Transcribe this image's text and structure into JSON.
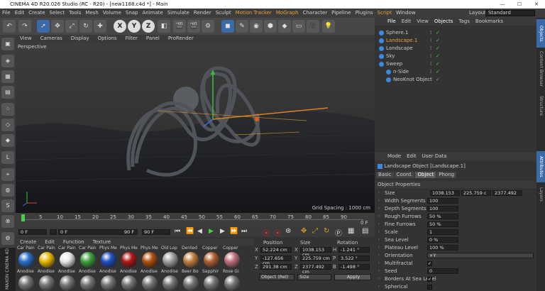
{
  "title_bar": {
    "text": "CINEMA 4D R20.026 Studio (RC - R20) - [new1188.c4d *] - Main"
  },
  "menu": {
    "items": [
      "File",
      "Edit",
      "Create",
      "Select",
      "Tools",
      "Mesh",
      "Volume",
      "Snap",
      "Animate",
      "Simulate",
      "Render",
      "Sculpt",
      "Motion Tracker",
      "MoGraph",
      "Character",
      "Pipeline",
      "Plugins",
      "Script",
      "Window"
    ],
    "layout_label": "Layout:",
    "layout_value": "Standard"
  },
  "toolbar": {
    "x": "X",
    "y": "Y",
    "z": "Z"
  },
  "viewport": {
    "menu": [
      "View",
      "Cameras",
      "Display",
      "Options",
      "Filter",
      "Panel",
      "ProRender"
    ],
    "label": "Perspective",
    "grid_spacing": "Grid Spacing : 1000 cm"
  },
  "timeline": {
    "ticks": [
      "0",
      "5",
      "10",
      "15",
      "20",
      "25",
      "30",
      "35",
      "40",
      "45",
      "50",
      "55",
      "60",
      "65",
      "70",
      "75",
      "80",
      "85",
      "90"
    ],
    "end_label": "0 F"
  },
  "transport": {
    "start": "0 F",
    "current": "0 F",
    "end": "90 F",
    "end2": "90 F"
  },
  "materials": {
    "menu": [
      "Create",
      "Edit",
      "Function",
      "Texture"
    ],
    "top_labels": [
      "Car Pain",
      "Car Pain",
      "Car Pain",
      "Car Pain",
      "Phys Me",
      "Phys Me",
      "Phys Me",
      "Old Lop",
      "Dented",
      "Copper",
      "Copper"
    ],
    "bottom_labels": [
      "Anodise",
      "Anodise",
      "Anodise",
      "Anodise",
      "Anodise",
      "Anodise",
      "Anodise",
      "Anodise",
      "Beer Bo",
      "Sapphir",
      "Rose Gi"
    ],
    "colors": [
      "#2a70c8",
      "#e8b800",
      "#e8e8e8",
      "#40a040",
      "#2050c0",
      "#b01818",
      "#b05010",
      "#a0a0a0",
      "#c08040",
      "#b06030",
      "#c07080"
    ]
  },
  "coordinates": {
    "headers": [
      "Position",
      "Size",
      "Rotation"
    ],
    "rows": [
      {
        "axis": "X",
        "pos": "52.224 cm",
        "size_axis": "X",
        "size": "1038.153 cm",
        "rot_axis": "H",
        "rot": "-1.241 °"
      },
      {
        "axis": "Y",
        "pos": "-127.656 cm",
        "size_axis": "Y",
        "size": "225.759 cm",
        "rot_axis": "P",
        "rot": "3.522 °"
      },
      {
        "axis": "Z",
        "pos": "291.38 cm",
        "size_axis": "Z",
        "size": "2377.492 cm",
        "rot_axis": "B",
        "rot": "-1.498 °"
      }
    ],
    "mode": "Object (Rel)",
    "size_mode": "Size",
    "apply": "Apply"
  },
  "objects": {
    "tabs": [
      "File",
      "Edit",
      "View",
      "Objects",
      "Tags",
      "Bookmarks"
    ],
    "items": [
      {
        "name": "Sphere.1",
        "indent": 0,
        "color": "#c8c8c8"
      },
      {
        "name": "Landscape.1",
        "indent": 0,
        "color": "#f0a030"
      },
      {
        "name": "Landscape",
        "indent": 0,
        "color": "#c8c8c8"
      },
      {
        "name": "Sky",
        "indent": 0,
        "color": "#c8c8c8"
      },
      {
        "name": "Sweep",
        "indent": 0,
        "color": "#c8c8c8"
      },
      {
        "name": "n-Side",
        "indent": 1,
        "color": "#c8c8c8"
      },
      {
        "name": "NeoKnot Object",
        "indent": 1,
        "color": "#c8c8c8"
      }
    ]
  },
  "attributes": {
    "menu": [
      "Mode",
      "Edit",
      "User Data"
    ],
    "object_title": "Landscape Object [Landscape.1]",
    "tabs": [
      "Basic",
      "Coord.",
      "Object",
      "Phong"
    ],
    "section": "Object Properties",
    "size_label": "Size",
    "size_values": [
      "1038.153",
      "225.759 c",
      "2377.492"
    ],
    "props": [
      {
        "label": "Width Segments",
        "value": "100"
      },
      {
        "label": "Depth Segments",
        "value": "100"
      },
      {
        "label": "Rough Furrows",
        "value": "50 %"
      },
      {
        "label": "Fine Furrows",
        "value": "50 %"
      },
      {
        "label": "Scale",
        "value": "1"
      },
      {
        "label": "Sea Level",
        "value": "0 %"
      },
      {
        "label": "Plateau Level",
        "value": "100 %"
      },
      {
        "label": "Orientation",
        "value": "+Y"
      },
      {
        "label": "Multifractal",
        "value": "✓"
      },
      {
        "label": "Seed",
        "value": "0"
      },
      {
        "label": "Borders At Sea Level",
        "value": "✓"
      },
      {
        "label": "Spherical",
        "value": ""
      }
    ]
  },
  "side_tabs": [
    "Content Browser",
    "Structure",
    "Attributes",
    "Layers"
  ],
  "maxon_logo": "MAXON CINEMA 4D"
}
